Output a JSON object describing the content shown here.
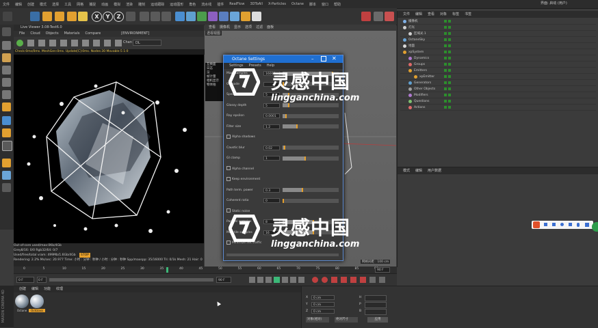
{
  "menubar": [
    "文件",
    "编辑",
    "创建",
    "模式",
    "选择",
    "工具",
    "网格",
    "捕捉",
    "动画",
    "模拟",
    "渲染",
    "雕刻",
    "运动跟踪",
    "运动图形",
    "角色",
    "流水线",
    "插件",
    "RealFlow",
    "3DToAll",
    "X-Particles",
    "Octane",
    "脚本",
    "窗口",
    "帮助"
  ],
  "right_header": {
    "interface_label": "界面: 启动 (用户)"
  },
  "toolbar": {
    "x": "X",
    "y": "Y",
    "z": "Z"
  },
  "live_viewer": {
    "title": "Live Viewer 3.08-Test6.0",
    "menu": [
      "File",
      "Cloud",
      "Objects",
      "Materials",
      "Compare",
      "[ENVIRONMENT]"
    ],
    "channel": "Chan",
    "dropdown": "DL",
    "status": "Check:0ms/0ms. MeshGen:0ms. Update[C]:0ms. Nodes:30 Movable:5 1:0",
    "stats": [
      "Out-of-core used/max:0Kb/4Gb",
      "Grey8/16: 0/0    Rgb32/64: 0/7",
      "Used/free/total vram: 499Mb/1.6Gb/4Gb",
      "Rendering: 2.2%   Ms/sec: 20.977   Time: 小时 : 分钟 : 秒钟 / 小时 : 分钟 : 秒钟   Spp/maxspp: 35/16000   Tri: 0/1k   Mesh: 21   Hair: 0"
    ],
    "badge": "STOP"
  },
  "viewport": {
    "menu": [
      "查看",
      "摄像机",
      "显示",
      "选项",
      "过滤",
      "面板"
    ],
    "label": "透视视图",
    "scale": "网格间距 : 100 cm"
  },
  "octane": {
    "title": "Octane Settings",
    "tabs": [
      "Settings",
      "Presets",
      "Help"
    ],
    "rows": [
      {
        "label": "Max. samples",
        "value": "16000",
        "fill": 0.9
      },
      {
        "label": "GI mode",
        "value": "",
        "fill": 0
      },
      {
        "label": "Specular depth",
        "value": "5",
        "fill": 0.1
      },
      {
        "label": "Glossy depth",
        "value": "5",
        "fill": 0.1
      },
      {
        "label": "Ray epsilon",
        "value": "0.0001",
        "fill": 0.05
      },
      {
        "label": "Filter size",
        "value": "1.2",
        "fill": 0.25
      },
      {
        "label": "Alpha shadows",
        "value": "",
        "fill": -1
      },
      {
        "label": "Caustic blur",
        "value": "0.02",
        "fill": 0.02
      },
      {
        "label": "GI clamp",
        "value": "1",
        "fill": 0.4
      },
      {
        "label": "Alpha channel",
        "value": "",
        "fill": -1
      },
      {
        "label": "Keep environment",
        "value": "",
        "fill": -1
      },
      {
        "label": "Path term. power",
        "value": "0.3",
        "fill": 0.35
      },
      {
        "label": "Coherent ratio",
        "value": "0",
        "fill": 0
      },
      {
        "label": "Static noise",
        "value": "",
        "fill": -1
      },
      {
        "label": "Parallel samples",
        "value": "8",
        "fill": 0.55
      },
      {
        "label": "Max tile samples",
        "value": "16",
        "fill": 0.55
      },
      {
        "label": "Minimize net traffic",
        "value": "",
        "fill": -1
      }
    ],
    "side": [
      "互换面",
      "日志",
      "渲",
      "帧计量",
      "相机显示",
      "物体拍"
    ]
  },
  "object_manager": {
    "menu": [
      "文件",
      "编辑",
      "查看",
      "对象",
      "标签",
      "书签"
    ],
    "rows": [
      {
        "name": "摄像机",
        "color": "#7fb0e6",
        "indent": 0
      },
      {
        "name": "灯光",
        "color": "#cfcfcf",
        "indent": 0
      },
      {
        "name": "区域光 1",
        "color": "#cfcfcf",
        "indent": 8
      },
      {
        "name": "OctaneSky",
        "color": "#6aa5d8",
        "indent": 0
      },
      {
        "name": "地面",
        "color": "#d9d9d9",
        "indent": 0
      },
      {
        "name": "xpSystem",
        "color": "#e0a030",
        "indent": 0
      },
      {
        "name": "Dynamics",
        "color": "#b07ad0",
        "indent": 8
      },
      {
        "name": "Groups",
        "color": "#e06a6a",
        "indent": 8
      },
      {
        "name": "Emitters",
        "color": "#e0a030",
        "indent": 8
      },
      {
        "name": "xpEmitter",
        "color": "#e0a030",
        "indent": 16
      },
      {
        "name": "Generators",
        "color": "#5fa0d0",
        "indent": 8
      },
      {
        "name": "Other Objects",
        "color": "#a0a0a0",
        "indent": 8
      },
      {
        "name": "Modifiers",
        "color": "#b07ad0",
        "indent": 8
      },
      {
        "name": "Questions",
        "color": "#7fc070",
        "indent": 8
      },
      {
        "name": "Actions",
        "color": "#e06a6a",
        "indent": 8
      }
    ]
  },
  "attribute_manager": {
    "menu": [
      "模式",
      "编辑",
      "用户数据"
    ]
  },
  "timeline": {
    "ticks": [
      "0",
      "5",
      "10",
      "15",
      "20",
      "25",
      "30",
      "35",
      "40",
      "45",
      "50",
      "55",
      "60",
      "65",
      "70",
      "75",
      "80",
      "85",
      "90"
    ],
    "current": "0 F",
    "start": "0 F",
    "end": "90 F",
    "end2": "90 F"
  },
  "materials": {
    "menu": [
      "创建",
      "编辑",
      "功能",
      "纹理"
    ],
    "items": [
      "Octane",
      "OctGlass"
    ]
  },
  "coords": {
    "labels": [
      "X",
      "Y",
      "Z"
    ],
    "values": [
      "0 cm",
      "0 cm",
      "0 cm"
    ],
    "rot": [
      "H",
      "P",
      "B"
    ],
    "mode1": "对象(相对)",
    "mode2": "绝对尺寸",
    "apply": "应用"
  },
  "watermark": {
    "cn": "灵感中国",
    "url": "lingganchina.com"
  },
  "bottom_logo": "MAXON CINEMA 4D"
}
